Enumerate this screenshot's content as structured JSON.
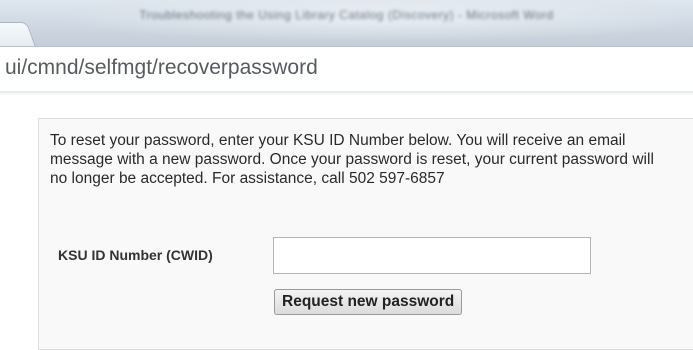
{
  "browser": {
    "window_title": "Troubleshooting the Using Library Catalog (Discovery) - Microsoft Word",
    "url_fragment": "ui/cmnd/selfmgt/recoverpassword"
  },
  "form": {
    "instructions": "To reset your password, enter your KSU ID Number below. You will receive an email message with a new password. Once your password is reset, your current password will no longer be accepted. For assistance, call 502 597-6857",
    "id_label": "KSU ID Number (CWID)",
    "id_value": "",
    "submit_label": "Request new password"
  }
}
